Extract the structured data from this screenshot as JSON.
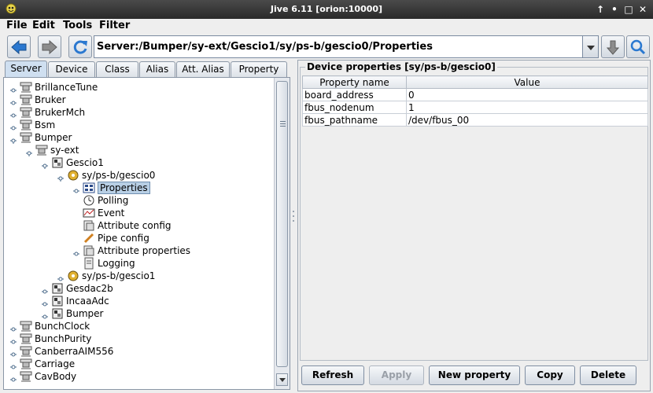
{
  "window": {
    "title": "Jive 6.11  [orion:10000]"
  },
  "menu": [
    "File",
    "Edit",
    "Tools",
    "Filter"
  ],
  "toolbar": {
    "path": "Server:/Bumper/sy-ext/Gescio1/sy/ps-b/gescio0/Properties"
  },
  "tabs": [
    "Server",
    "Device",
    "Class",
    "Alias",
    "Att. Alias",
    "Property"
  ],
  "tree": [
    "BrillanceTune",
    "Bruker",
    "BrukerMch",
    "Bsm",
    "Bumper",
    "sy-ext",
    "Gescio1",
    "sy/ps-b/gescio0",
    "Properties",
    "Polling",
    "Event",
    "Attribute config",
    "Pipe config",
    "Attribute properties",
    "Logging",
    "sy/ps-b/gescio1",
    "Gesdac2b",
    "IncaaAdc",
    "Bumper",
    "BunchClock",
    "BunchPurity",
    "CanberraAIM556",
    "Carriage",
    "CavBody"
  ],
  "properties_panel": {
    "title": "Device properties [sy/ps-b/gescio0]",
    "columns": [
      "Property name",
      "Value"
    ],
    "rows": [
      [
        "board_address",
        "0"
      ],
      [
        "fbus_nodenum",
        "1"
      ],
      [
        "fbus_pathname",
        "/dev/fbus_00"
      ]
    ]
  },
  "buttons": {
    "refresh": "Refresh",
    "apply": "Apply",
    "new_property": "New property",
    "copy": "Copy",
    "delete": "Delete"
  },
  "colors": {
    "selection": "#b8cfe5",
    "accent_blue": "#2a78d0"
  }
}
